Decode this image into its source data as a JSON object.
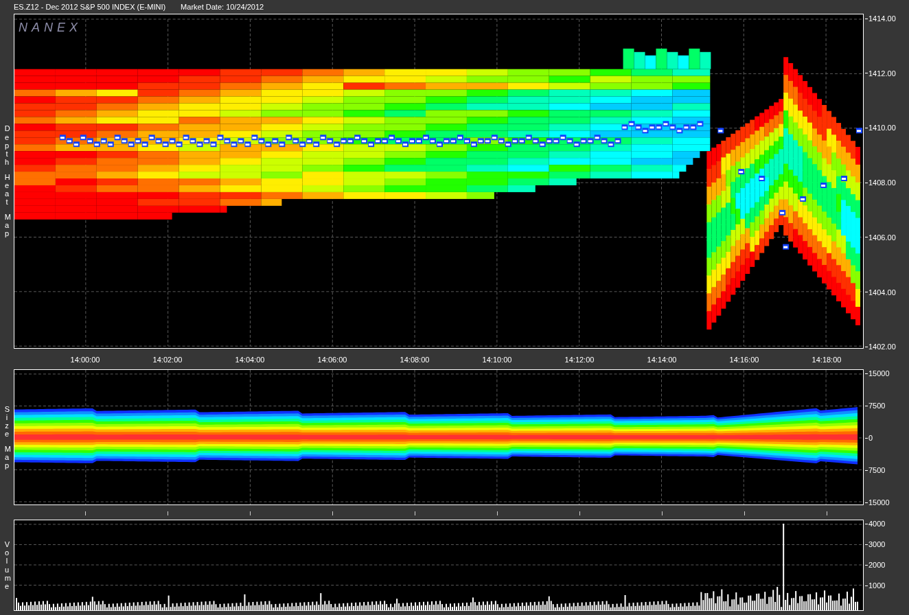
{
  "header": {
    "title": "ES.Z12 - Dec 2012 S&P 500 INDEX (E-MINI)",
    "market_date": "Market Date: 10/24/2012"
  },
  "heat_map": {
    "logo": "NANEX",
    "side_label": [
      "Depth",
      "Heat",
      "Map"
    ],
    "price_ticks": [
      "1414.00",
      "1412.00",
      "1410.00",
      "1408.00",
      "1406.00",
      "1404.00",
      "1402.00"
    ]
  },
  "time_axis": [
    "14:00:00",
    "14:02:00",
    "14:04:00",
    "14:06:00",
    "14:08:00",
    "14:10:00",
    "14:12:00",
    "14:14:00",
    "14:16:00",
    "14:18:00"
  ],
  "size_map": {
    "side_label": [
      "Size",
      "Map"
    ],
    "ticks": [
      "15000",
      "7500",
      "0",
      "7500",
      "15000"
    ]
  },
  "volume": {
    "side_label": [
      "Volume"
    ],
    "ticks": [
      "4000",
      "3000",
      "2000",
      "1000"
    ]
  }
}
